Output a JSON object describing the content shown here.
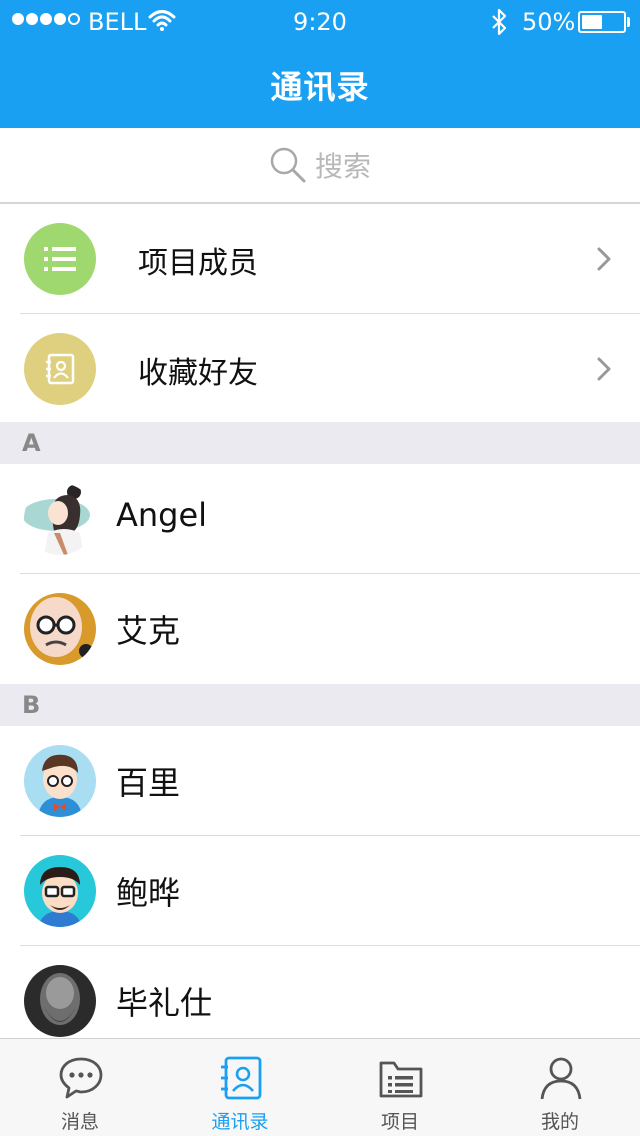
{
  "status_bar": {
    "carrier": "BELL",
    "time": "9:20",
    "battery_percent": "50%",
    "battery_level": 0.5,
    "signal_bars": 4,
    "signal_total": 5
  },
  "header": {
    "title": "通讯录",
    "accent_color": "#1aa0f2"
  },
  "search": {
    "placeholder": "搜索",
    "icon": "search-icon"
  },
  "groups": [
    {
      "label": "项目成员",
      "icon": "list-icon",
      "color": "#9fd86f"
    },
    {
      "label": "收藏好友",
      "icon": "address-book-icon",
      "color": "#dfd07f"
    }
  ],
  "sections": [
    {
      "letter": "A",
      "contacts": [
        {
          "name": "Angel"
        },
        {
          "name": "艾克"
        }
      ]
    },
    {
      "letter": "B",
      "contacts": [
        {
          "name": "百里"
        },
        {
          "name": "鲍晔"
        },
        {
          "name": "毕礼仕"
        }
      ]
    }
  ],
  "tab_bar": {
    "tabs": [
      {
        "label": "消息",
        "icon": "chat-bubble-icon",
        "active": false
      },
      {
        "label": "通讯录",
        "icon": "contacts-icon",
        "active": true
      },
      {
        "label": "项目",
        "icon": "folder-list-icon",
        "active": false
      },
      {
        "label": "我的",
        "icon": "person-icon",
        "active": false
      }
    ]
  }
}
